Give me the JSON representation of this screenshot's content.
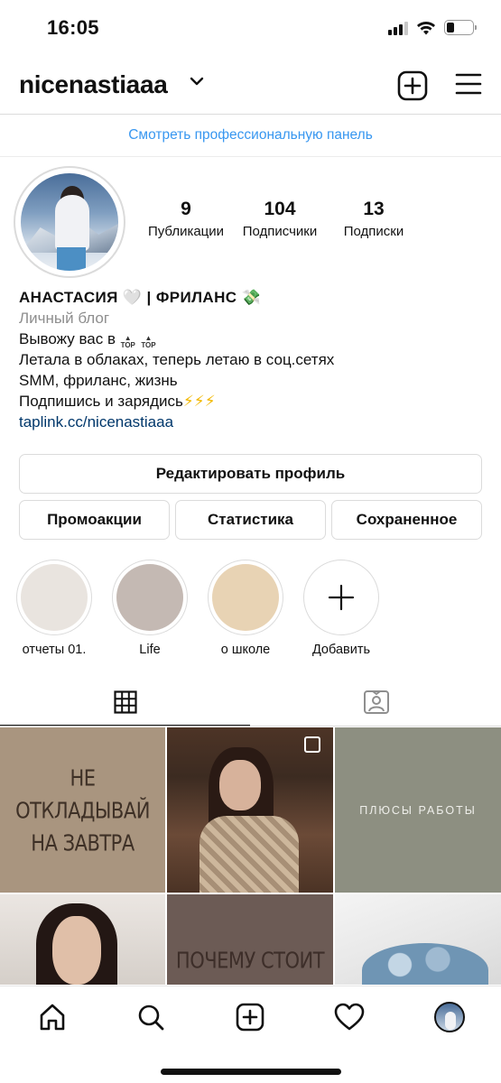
{
  "status_bar": {
    "time": "16:05",
    "battery_level": 0.3
  },
  "header": {
    "username": "nicenastiaaa",
    "icons": {
      "chevron": "chevron-down-icon",
      "add": "plus-square-icon",
      "menu": "hamburger-menu-icon"
    }
  },
  "pro_dashboard": {
    "label": "Смотреть профессиональную панель"
  },
  "stats": {
    "posts": {
      "value": "9",
      "label": "Публикации"
    },
    "followers": {
      "value": "104",
      "label": "Подписчики"
    },
    "following": {
      "value": "13",
      "label": "Подписки"
    }
  },
  "bio": {
    "name": "АНАСТАСИЯ 🤍 | ФРИЛАНС 💸",
    "category": "Личный блог",
    "line1": "Вывожу вас в",
    "top_badge": "TOP",
    "line2": "Летала в облаках, теперь летаю в соц.сетях",
    "line3": "SMM, фриланс, жизнь",
    "line4": "Подпишись и зарядись",
    "bolts": "⚡⚡⚡",
    "link": "taplink.cc/nicenastiaaa"
  },
  "buttons": {
    "edit_profile": "Редактировать профиль",
    "promotions": "Промоакции",
    "insights": "Статистика",
    "saved": "Сохраненное"
  },
  "highlights": [
    {
      "label": "отчеты 01.",
      "color": "#e9e4df"
    },
    {
      "label": "Life",
      "color": "#c4b9b3"
    },
    {
      "label": "о школе",
      "color": "#e8d3b4"
    },
    {
      "label": "Добавить",
      "icon": "plus-icon"
    }
  ],
  "tabs": {
    "grid_icon": "grid-icon",
    "tagged_icon": "tagged-person-icon"
  },
  "posts": {
    "post1_text": "НЕ ОТКЛАДЫВАЙ\nНА ЗАВТРА",
    "post3_text": "ПЛЮСЫ РАБОТЫ",
    "post5_text": "ПОЧЕМУ СТОИТ"
  },
  "bottom_nav": {
    "icons": [
      "home-icon",
      "search-icon",
      "add-post-icon",
      "heart-icon",
      "profile-avatar"
    ]
  },
  "colors": {
    "link": "#3897f0",
    "bio_link": "#00376b",
    "border": "#dbdbdb"
  }
}
